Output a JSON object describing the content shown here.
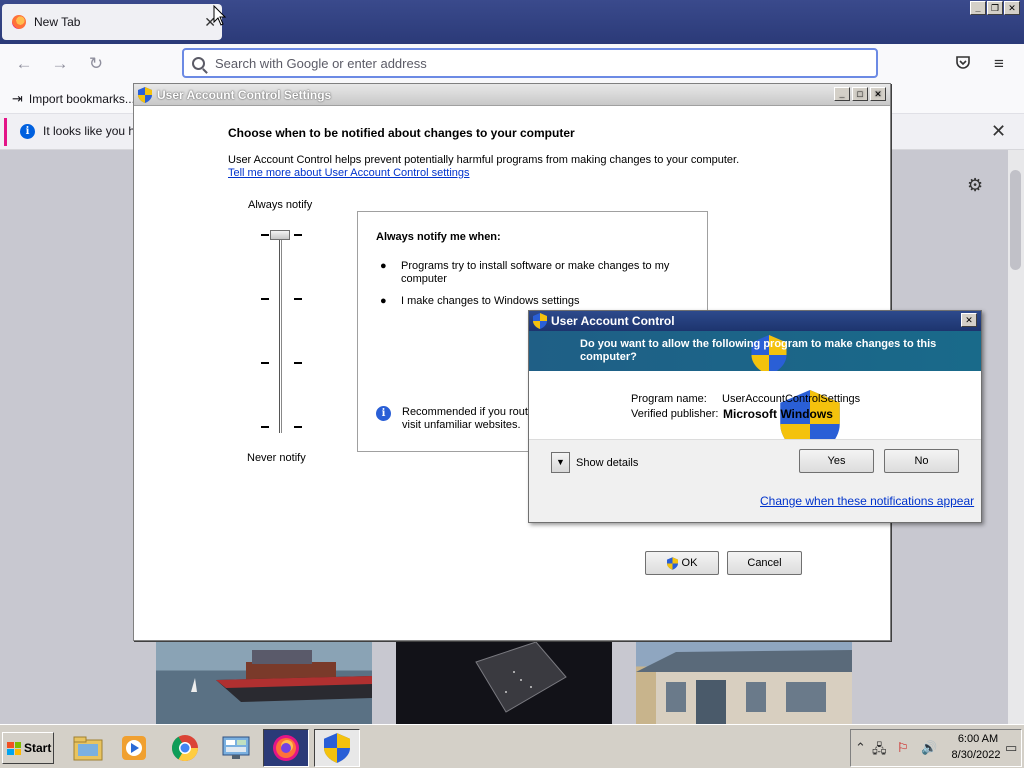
{
  "browser": {
    "tab_title": "New Tab",
    "tab_close": "✕",
    "url_placeholder": "Search with Google or enter address",
    "bookmark_import": "Import bookmarks...",
    "notice_text": "It looks like you ha",
    "notice_close": "✕",
    "window_buttons": [
      "_",
      "❐",
      "✕"
    ]
  },
  "uac_settings": {
    "title": "User Account Control Settings",
    "heading": "Choose when to be notified about changes to your computer",
    "description": "User Account Control helps prevent potentially harmful programs from making changes to your computer.",
    "learn_more_link": "Tell me more about User Account Control settings",
    "slider_top_label": "Always notify",
    "slider_bottom_label": "Never notify",
    "slider_level": "Always notify",
    "box_title": "Always notify me when:",
    "bullets": [
      "Programs try to install software or make changes to my computer",
      "I make changes to Windows settings"
    ],
    "recommendation": "Recommended if you routi visit unfamiliar websites.",
    "ok_label": "OK",
    "cancel_label": "Cancel",
    "window_buttons": [
      "_",
      "□",
      "✕"
    ]
  },
  "uac_prompt": {
    "title": "User Account Control",
    "question": "Do you want to allow the following program to make changes to this computer?",
    "program_name_label": "Program name:",
    "program_name_value": "UserAccountControlSettings",
    "publisher_label": "Verified publisher:",
    "publisher_value": "Microsoft Windows",
    "show_details": "Show details",
    "yes_label": "Yes",
    "no_label": "No",
    "change_link": "Change when these notifications appear",
    "close": "✕"
  },
  "taskbar": {
    "start_label": "Start",
    "time": "6:00 AM",
    "date": "8/30/2022",
    "apps": [
      "file-explorer",
      "media-player",
      "chrome",
      "control-panel",
      "firefox",
      "uac-shield"
    ]
  },
  "colors": {
    "uac_banner": "#1f5f86",
    "firefox_titlebar": "#2b3a78",
    "link": "#0033cc"
  }
}
